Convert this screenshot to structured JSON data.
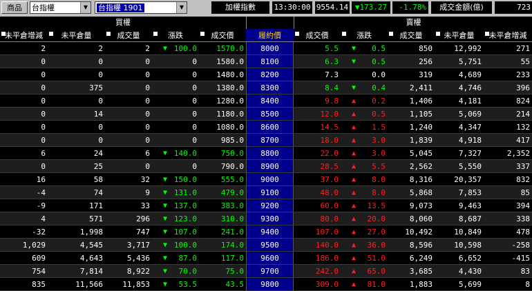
{
  "toolbar": {
    "product_label": "商品",
    "product_select": "台指權",
    "contract_select": "台指權  1901",
    "index_label": "加權指數",
    "time": "13:30:00",
    "index_value": "9554.14",
    "index_change": "173.27",
    "index_change_dir": "up",
    "index_pct": "-1.78%",
    "turnover_label": "成交金額(億)",
    "turnover_value": "723"
  },
  "table": {
    "call_group": "買權",
    "put_group": "賣權",
    "columns": [
      "未平倉增減",
      "未平倉量",
      "成交量",
      "漲跌",
      "成交價",
      "履約價",
      "成交價",
      "漲跌",
      "成交量",
      "未平倉量",
      "未平倉增減"
    ],
    "rows": [
      {
        "c_oi_chg": "2",
        "c_oi": "2",
        "c_vol": "2",
        "c_chg": "100.0",
        "c_chg_dir": "down",
        "c_price": "1570.0",
        "strike": "8000",
        "p_price": "5.5",
        "p_chg": "0.5",
        "p_chg_dir": "down",
        "p_vol": "850",
        "p_oi": "12,992",
        "p_oi_chg": "271"
      },
      {
        "c_oi_chg": "0",
        "c_oi": "0",
        "c_vol": "0",
        "c_chg": "0",
        "c_chg_dir": "none",
        "c_price": "1580.0",
        "strike": "8100",
        "p_price": "6.3",
        "p_chg": "0.5",
        "p_chg_dir": "down",
        "p_vol": "256",
        "p_oi": "5,751",
        "p_oi_chg": "55"
      },
      {
        "c_oi_chg": "0",
        "c_oi": "0",
        "c_vol": "0",
        "c_chg": "0",
        "c_chg_dir": "none",
        "c_price": "1480.0",
        "strike": "8200",
        "p_price": "7.3",
        "p_chg": "0.0",
        "p_chg_dir": "none",
        "p_vol": "319",
        "p_oi": "4,689",
        "p_oi_chg": "233"
      },
      {
        "c_oi_chg": "0",
        "c_oi": "375",
        "c_vol": "0",
        "c_chg": "0",
        "c_chg_dir": "none",
        "c_price": "1380.0",
        "strike": "8300",
        "p_price": "8.4",
        "p_chg": "0.4",
        "p_chg_dir": "down",
        "p_vol": "2,411",
        "p_oi": "4,746",
        "p_oi_chg": "396"
      },
      {
        "c_oi_chg": "0",
        "c_oi": "0",
        "c_vol": "0",
        "c_chg": "0",
        "c_chg_dir": "none",
        "c_price": "1280.0",
        "strike": "8400",
        "p_price": "9.8",
        "p_chg": "0.2",
        "p_chg_dir": "up",
        "p_vol": "1,406",
        "p_oi": "4,181",
        "p_oi_chg": "824"
      },
      {
        "c_oi_chg": "0",
        "c_oi": "14",
        "c_vol": "0",
        "c_chg": "0",
        "c_chg_dir": "none",
        "c_price": "1180.0",
        "strike": "8500",
        "p_price": "12.0",
        "p_chg": "0.5",
        "p_chg_dir": "up",
        "p_vol": "1,105",
        "p_oi": "5,069",
        "p_oi_chg": "214"
      },
      {
        "c_oi_chg": "0",
        "c_oi": "0",
        "c_vol": "0",
        "c_chg": "0",
        "c_chg_dir": "none",
        "c_price": "1080.0",
        "strike": "8600",
        "p_price": "14.5",
        "p_chg": "1.5",
        "p_chg_dir": "up",
        "p_vol": "1,240",
        "p_oi": "4,347",
        "p_oi_chg": "132"
      },
      {
        "c_oi_chg": "0",
        "c_oi": "0",
        "c_vol": "0",
        "c_chg": "0",
        "c_chg_dir": "none",
        "c_price": "985.0",
        "strike": "8700",
        "p_price": "18.0",
        "p_chg": "3.0",
        "p_chg_dir": "up",
        "p_vol": "1,839",
        "p_oi": "4,918",
        "p_oi_chg": "417"
      },
      {
        "c_oi_chg": "6",
        "c_oi": "24",
        "c_vol": "6",
        "c_chg": "140.0",
        "c_chg_dir": "down",
        "c_price": "750.0",
        "strike": "8800",
        "p_price": "22.0",
        "p_chg": "3.0",
        "p_chg_dir": "up",
        "p_vol": "5,045",
        "p_oi": "7,327",
        "p_oi_chg": "2,352"
      },
      {
        "c_oi_chg": "0",
        "c_oi": "25",
        "c_vol": "0",
        "c_chg": "0",
        "c_chg_dir": "none",
        "c_price": "790.0",
        "strike": "8900",
        "p_price": "28.5",
        "p_chg": "5.5",
        "p_chg_dir": "up",
        "p_vol": "2,562",
        "p_oi": "5,550",
        "p_oi_chg": "337"
      },
      {
        "c_oi_chg": "16",
        "c_oi": "58",
        "c_vol": "32",
        "c_chg": "150.0",
        "c_chg_dir": "down",
        "c_price": "555.0",
        "strike": "9000",
        "p_price": "37.0",
        "p_chg": "8.0",
        "p_chg_dir": "up",
        "p_vol": "8,316",
        "p_oi": "20,357",
        "p_oi_chg": "832"
      },
      {
        "c_oi_chg": "-4",
        "c_oi": "74",
        "c_vol": "9",
        "c_chg": "131.0",
        "c_chg_dir": "down",
        "c_price": "479.0",
        "strike": "9100",
        "p_price": "48.0",
        "p_chg": "8.0",
        "p_chg_dir": "up",
        "p_vol": "5,868",
        "p_oi": "7,853",
        "p_oi_chg": "85"
      },
      {
        "c_oi_chg": "-9",
        "c_oi": "171",
        "c_vol": "33",
        "c_chg": "137.0",
        "c_chg_dir": "down",
        "c_price": "383.0",
        "strike": "9200",
        "p_price": "60.0",
        "p_chg": "13.5",
        "p_chg_dir": "up",
        "p_vol": "9,073",
        "p_oi": "9,463",
        "p_oi_chg": "394"
      },
      {
        "c_oi_chg": "4",
        "c_oi": "571",
        "c_vol": "296",
        "c_chg": "123.0",
        "c_chg_dir": "down",
        "c_price": "310.0",
        "strike": "9300",
        "p_price": "80.0",
        "p_chg": "20.0",
        "p_chg_dir": "up",
        "p_vol": "8,060",
        "p_oi": "8,687",
        "p_oi_chg": "338"
      },
      {
        "c_oi_chg": "-32",
        "c_oi": "1,998",
        "c_vol": "747",
        "c_chg": "107.0",
        "c_chg_dir": "down",
        "c_price": "241.0",
        "strike": "9400",
        "p_price": "107.0",
        "p_chg": "27.0",
        "p_chg_dir": "up",
        "p_vol": "10,492",
        "p_oi": "10,849",
        "p_oi_chg": "478"
      },
      {
        "c_oi_chg": "1,029",
        "c_oi": "4,545",
        "c_vol": "3,717",
        "c_chg": "100.0",
        "c_chg_dir": "down",
        "c_price": "174.0",
        "strike": "9500",
        "p_price": "140.0",
        "p_chg": "36.0",
        "p_chg_dir": "up",
        "p_vol": "8,596",
        "p_oi": "10,598",
        "p_oi_chg": "-258"
      },
      {
        "c_oi_chg": "609",
        "c_oi": "4,643",
        "c_vol": "5,436",
        "c_chg": "87.0",
        "c_chg_dir": "down",
        "c_price": "117.0",
        "strike": "9600",
        "p_price": "186.0",
        "p_chg": "51.0",
        "p_chg_dir": "up",
        "p_vol": "6,249",
        "p_oi": "6,652",
        "p_oi_chg": "-415"
      },
      {
        "c_oi_chg": "754",
        "c_oi": "7,814",
        "c_vol": "8,922",
        "c_chg": "70.0",
        "c_chg_dir": "down",
        "c_price": "75.0",
        "strike": "9700",
        "p_price": "242.0",
        "p_chg": "65.0",
        "p_chg_dir": "up",
        "p_vol": "3,685",
        "p_oi": "4,430",
        "p_oi_chg": "83"
      },
      {
        "c_oi_chg": "835",
        "c_oi": "11,566",
        "c_vol": "11,853",
        "c_chg": "53.5",
        "c_chg_dir": "down",
        "c_price": "43.5",
        "strike": "9800",
        "p_price": "309.0",
        "p_chg": "81.0",
        "p_chg_dir": "up",
        "p_vol": "1,883",
        "p_oi": "5,699",
        "p_oi_chg": "8"
      }
    ]
  },
  "colors": {
    "up": "#ff2020",
    "down": "#00ff00",
    "strike_bg": "#00008b"
  }
}
